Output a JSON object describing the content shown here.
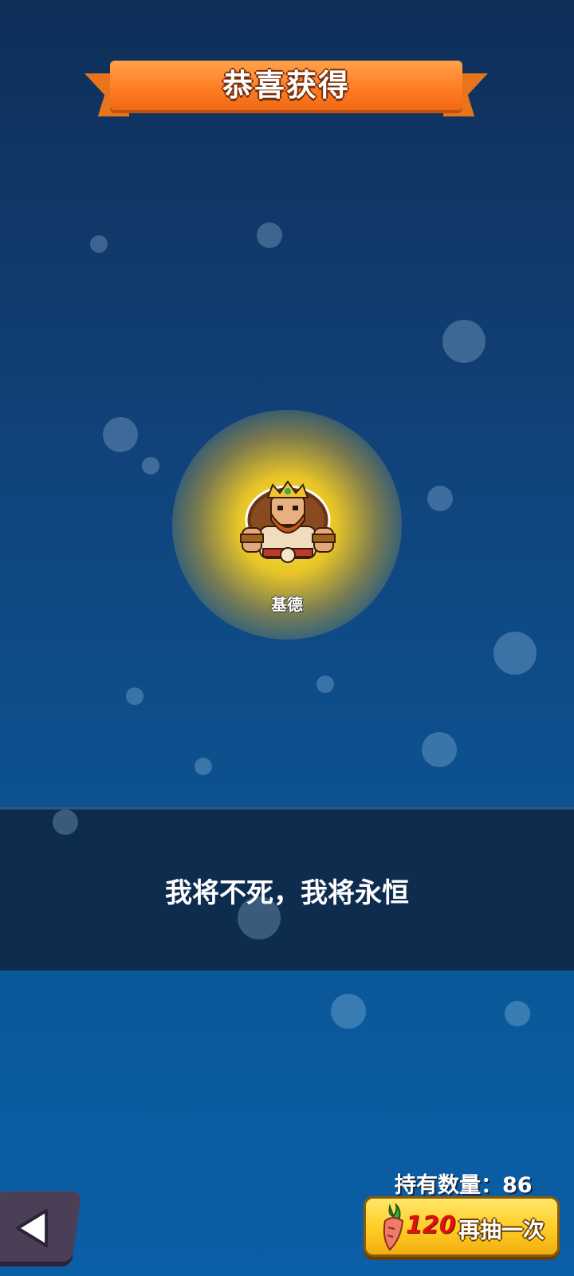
{
  "header": {
    "title": "恭喜获得"
  },
  "reward": {
    "hero_name": "基德",
    "hero_icon": "barbarian-king-portrait"
  },
  "quote": "我将不死，我将永恒",
  "footer": {
    "owned_label": "持有数量：86",
    "redraw_cost": "120",
    "redraw_label": "再抽一次",
    "back_icon": "back-arrow-icon",
    "currency_icon": "carrot-icon"
  }
}
